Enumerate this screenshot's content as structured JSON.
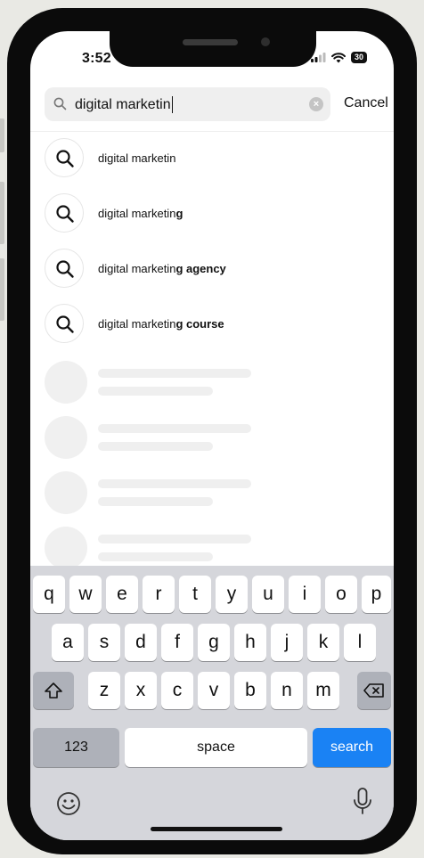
{
  "status_bar": {
    "time": "3:52",
    "battery": "30"
  },
  "search": {
    "query": "digital marketin",
    "cancel_label": "Cancel"
  },
  "suggestions": [
    {
      "prefix": "digital marketin",
      "suffix": ""
    },
    {
      "prefix": "digital marketin",
      "suffix": "g"
    },
    {
      "prefix": "digital marketin",
      "suffix": "g agency"
    },
    {
      "prefix": "digital marketin",
      "suffix": "g course"
    }
  ],
  "keyboard": {
    "row1": [
      "q",
      "w",
      "e",
      "r",
      "t",
      "y",
      "u",
      "i",
      "o",
      "p"
    ],
    "row2": [
      "a",
      "s",
      "d",
      "f",
      "g",
      "h",
      "j",
      "k",
      "l"
    ],
    "row3": [
      "z",
      "x",
      "c",
      "v",
      "b",
      "n",
      "m"
    ],
    "numbers_label": "123",
    "space_label": "space",
    "search_label": "search"
  },
  "colors": {
    "accent": "#1a82f4",
    "keyboard_bg": "#d5d6db"
  }
}
